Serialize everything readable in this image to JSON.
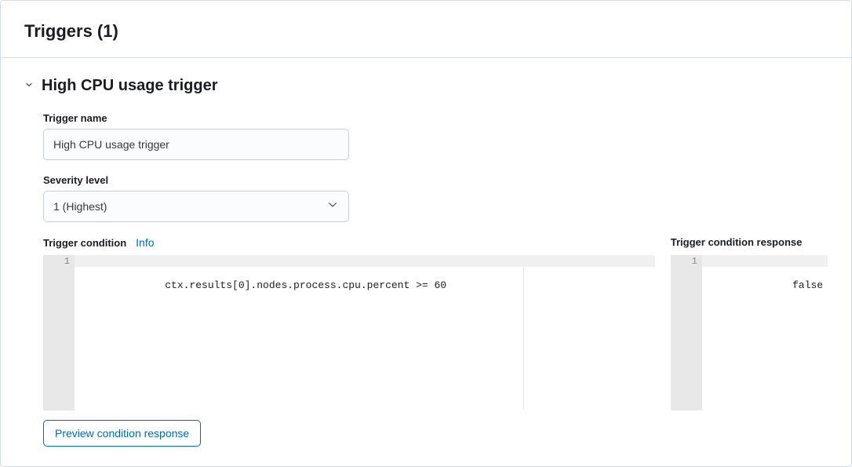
{
  "panel": {
    "title": "Triggers (1)"
  },
  "trigger": {
    "heading": "High CPU usage trigger",
    "name_label": "Trigger name",
    "name_value": "High CPU usage trigger",
    "severity_label": "Severity level",
    "severity_value": "1 (Highest)",
    "condition_label": "Trigger condition",
    "info_link": "Info",
    "condition_code": "ctx.results[0].nodes.process.cpu.percent >= 60",
    "condition_line_number": "1",
    "response_label": "Trigger condition response",
    "response_value": "false",
    "response_line_number": "1",
    "preview_button": "Preview condition response"
  }
}
